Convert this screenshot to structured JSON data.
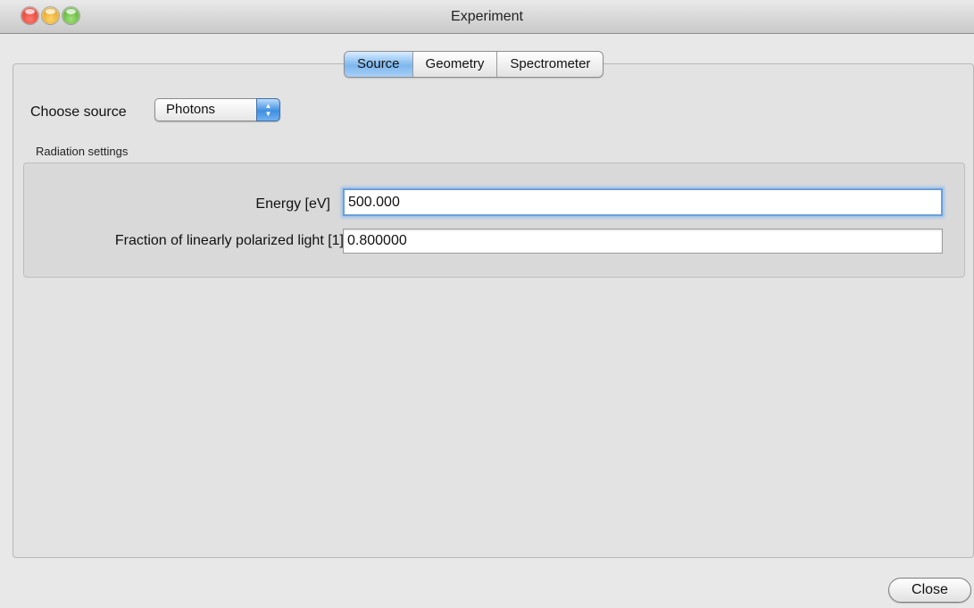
{
  "window": {
    "title": "Experiment"
  },
  "tabs": [
    {
      "label": "Source",
      "active": true
    },
    {
      "label": "Geometry",
      "active": false
    },
    {
      "label": "Spectrometer",
      "active": false
    }
  ],
  "source": {
    "choose_label": "Choose source",
    "selected": "Photons",
    "arrows_icon": "up-down-chevrons-icon"
  },
  "radiation": {
    "group_label": "Radiation settings",
    "energy_label": "Energy [eV]",
    "energy_value": "500.000",
    "fraction_label": "Fraction of linearly polarized light [1]",
    "fraction_value": "0.800000"
  },
  "footer": {
    "close_label": "Close"
  },
  "colors": {
    "tab_active": "#7db7ee",
    "focus_ring": "#6c9fd9",
    "close_light": "#d0261a",
    "minimize_light": "#d6930d",
    "zoom_light": "#3c9a1c"
  }
}
